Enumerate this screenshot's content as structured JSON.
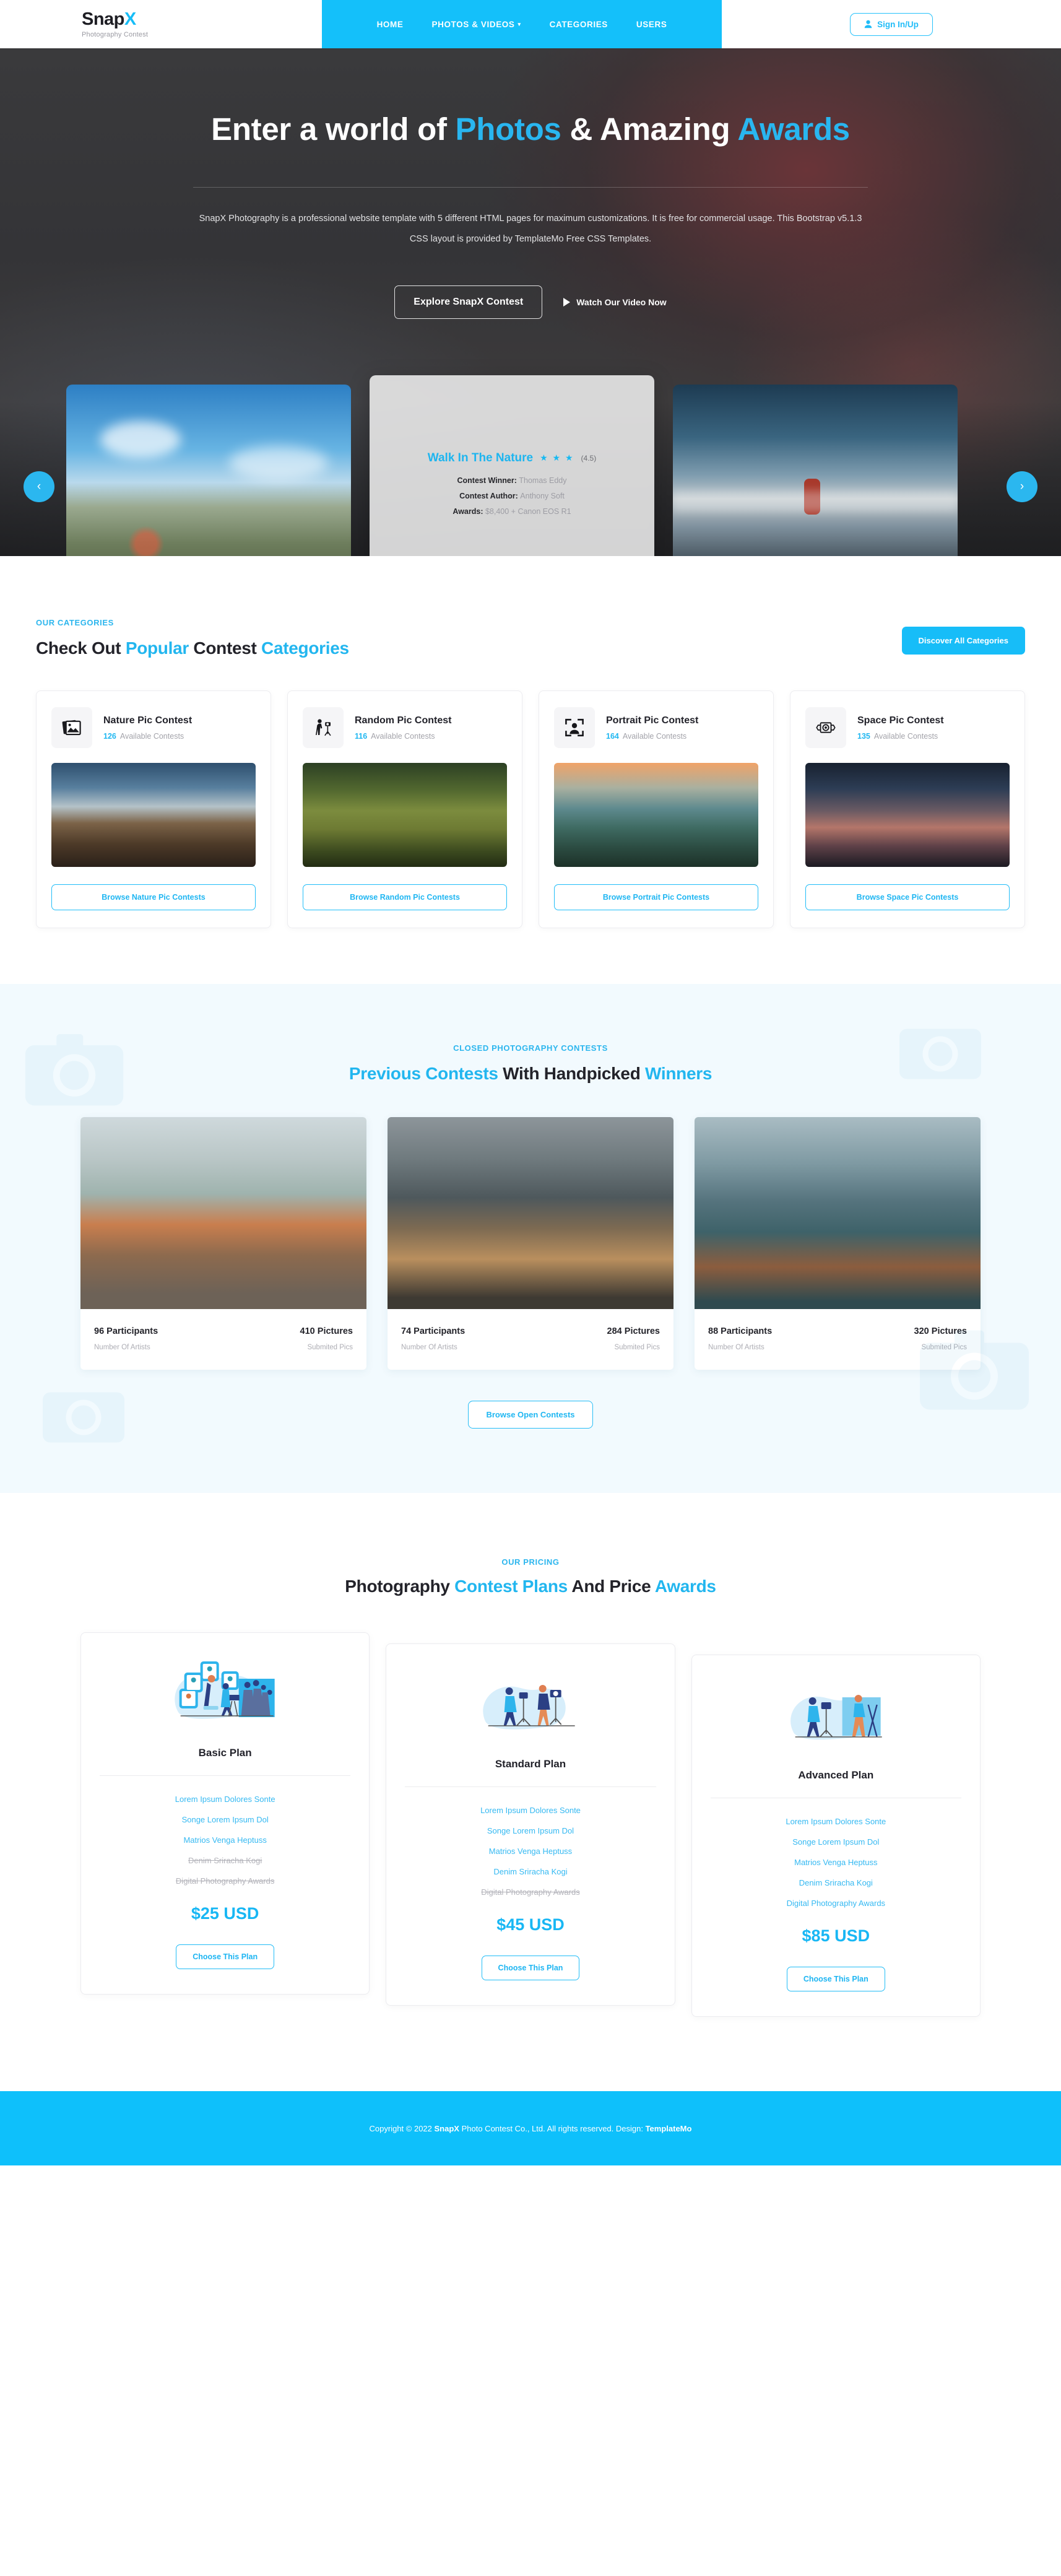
{
  "brand": {
    "name_main": "Snap",
    "name_accent": "X",
    "tagline": "Photography Contest"
  },
  "nav": {
    "items": [
      {
        "label": "HOME",
        "has_caret": false
      },
      {
        "label": "PHOTOS & VIDEOS",
        "has_caret": true
      },
      {
        "label": "CATEGORIES",
        "has_caret": false
      },
      {
        "label": "USERS",
        "has_caret": false
      }
    ],
    "signin_label": "Sign In/Up"
  },
  "hero": {
    "title_p1": "Enter a world of ",
    "title_hl1": "Photos",
    "title_p2": " & Amazing ",
    "title_hl2": "Awards",
    "paragraph": "SnapX Photography is a professional website template with 5 different HTML pages for maximum customizations. It is free for commercial usage. This Bootstrap v5.1.3 CSS layout is provided by TemplateMo Free CSS Templates.",
    "cta_primary": "Explore SnapX Contest",
    "cta_video": "Watch Our Video Now",
    "arrow_prev": "‹",
    "arrow_next": "›"
  },
  "slider": {
    "center": {
      "title": "Walk In The Nature",
      "stars": "★ ★ ★",
      "rating": "(4.5)",
      "winner_label": "Contest Winner:",
      "winner_value": "Thomas Eddy",
      "author_label": "Contest Author:",
      "author_value": "Anthony Soft",
      "awards_label": "Awards:",
      "awards_value": "$8,400 + Canon EOS R1"
    }
  },
  "categories": {
    "label": "OUR CATEGORIES",
    "h_p1": "Check Out ",
    "h_hl1": "Popular",
    "h_p2": " Contest ",
    "h_hl2": "Categories",
    "discover_label": "Discover All Categories",
    "available_text": "Available Contests",
    "items": [
      {
        "name": "Nature Pic Contest",
        "count": "126",
        "button": "Browse Nature Pic Contests",
        "icon": "photo-stack-icon",
        "img": "img-nature"
      },
      {
        "name": "Random Pic Contest",
        "count": "116",
        "button": "Browse Random Pic Contests",
        "icon": "photographer-icon",
        "img": "img-deer"
      },
      {
        "name": "Portrait Pic Contest",
        "count": "164",
        "button": "Browse Portrait Pic Contests",
        "icon": "portrait-frame-icon",
        "img": "img-forest"
      },
      {
        "name": "Space Pic Contest",
        "count": "135",
        "button": "Browse Space Pic Contests",
        "icon": "vintage-camera-icon",
        "img": "img-space"
      }
    ]
  },
  "previous": {
    "label": "CLOSED PHOTOGRAPHY CONTESTS",
    "h_hl1": "Previous Contests",
    "h_p1": " With Handpicked ",
    "h_hl2": "Winners",
    "browse_label": "Browse Open Contests",
    "cards": [
      {
        "participants": "96 Participants",
        "participants_label": "Number Of Artists",
        "pictures": "410 Pictures",
        "pictures_label": "Submited Pics",
        "img": "pimg-1"
      },
      {
        "participants": "74 Participants",
        "participants_label": "Number Of Artists",
        "pictures": "284 Pictures",
        "pictures_label": "Submited Pics",
        "img": "pimg-2"
      },
      {
        "participants": "88 Participants",
        "participants_label": "Number Of Artists",
        "pictures": "320 Pictures",
        "pictures_label": "Submited Pics",
        "img": "pimg-3"
      }
    ]
  },
  "pricing": {
    "label": "OUR PRICING",
    "h_p1": "Photography ",
    "h_hl1": "Contest Plans",
    "h_p2": " And Price ",
    "h_hl2": "Awards",
    "choose_label": "Choose This Plan",
    "plans": [
      {
        "name": "Basic Plan",
        "price": "$25 USD",
        "features": [
          {
            "text": "Lorem Ipsum Dolores Sonte",
            "enabled": true
          },
          {
            "text": "Songe Lorem Ipsum Dol",
            "enabled": true
          },
          {
            "text": "Matrios Venga Heptuss",
            "enabled": true
          },
          {
            "text": "Denim Sriracha Kogi",
            "enabled": false
          },
          {
            "text": "Digital Photography Awards",
            "enabled": false
          }
        ]
      },
      {
        "name": "Standard Plan",
        "price": "$45 USD",
        "features": [
          {
            "text": "Lorem Ipsum Dolores Sonte",
            "enabled": true
          },
          {
            "text": "Songe Lorem Ipsum Dol",
            "enabled": true
          },
          {
            "text": "Matrios Venga Heptuss",
            "enabled": true
          },
          {
            "text": "Denim Sriracha Kogi",
            "enabled": true
          },
          {
            "text": "Digital Photography Awards",
            "enabled": false
          }
        ]
      },
      {
        "name": "Advanced Plan",
        "price": "$85 USD",
        "features": [
          {
            "text": "Lorem Ipsum Dolores Sonte",
            "enabled": true
          },
          {
            "text": "Songe Lorem Ipsum Dol",
            "enabled": true
          },
          {
            "text": "Matrios Venga Heptuss",
            "enabled": true
          },
          {
            "text": "Denim Sriracha Kogi",
            "enabled": true
          },
          {
            "text": "Digital Photography Awards",
            "enabled": true
          }
        ]
      }
    ]
  },
  "footer": {
    "copy_p1": "Copyright © 2022 ",
    "copy_b1": "SnapX",
    "copy_p2": " Photo Contest Co., Ltd. All rights reserved. Design: ",
    "copy_b2": "TemplateMo"
  }
}
